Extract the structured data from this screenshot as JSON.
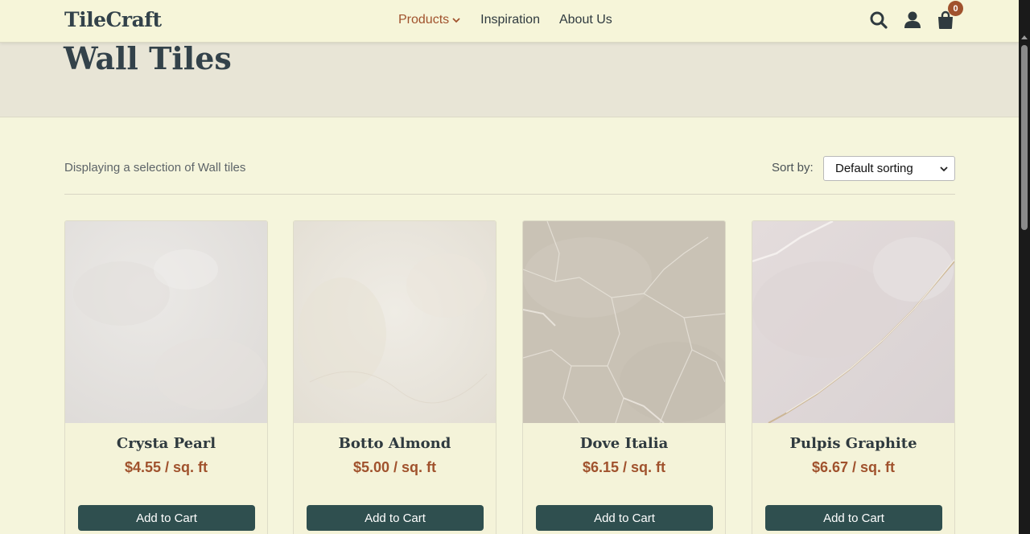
{
  "header": {
    "logo": "TileCraft",
    "nav": [
      "Products",
      "Inspiration",
      "About Us"
    ],
    "active_nav": "Products",
    "cart_count": "0"
  },
  "page": {
    "title": "Wall Tiles",
    "results_text": "Displaying a selection of Wall tiles",
    "sort_label": "Sort by:",
    "sort_value": "Default sorting"
  },
  "products": [
    {
      "name": "Crysta Pearl",
      "price": "$4.55 / sq. ft",
      "button": "Add to Cart"
    },
    {
      "name": "Botto Almond",
      "price": "$5.00 / sq. ft",
      "button": "Add to Cart"
    },
    {
      "name": "Dove Italia",
      "price": "$6.15 / sq. ft",
      "button": "Add to Cart"
    },
    {
      "name": "Pulpis Graphite",
      "price": "$6.67 / sq. ft",
      "button": "Add to Cart"
    }
  ],
  "colors": {
    "background": "#f5f5dc",
    "accent": "#a0522d",
    "button": "#2f4f4f",
    "text": "#2f3a3f"
  },
  "icons": [
    "search-icon",
    "user-icon",
    "shopping-bag-icon",
    "chevron-down-icon"
  ]
}
